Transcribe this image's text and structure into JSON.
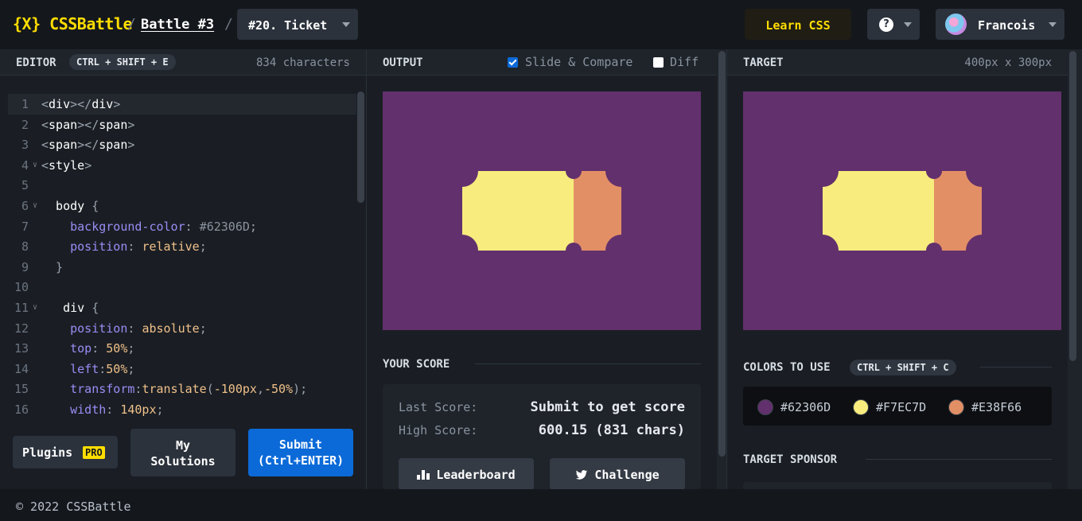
{
  "header": {
    "logo": "{X} CSSBattle",
    "separator": "/",
    "battle_label": "Battle #3",
    "target_label": "#20. Ticket",
    "learn_label": "Learn CSS",
    "help_label": "?",
    "user_name": "Francois"
  },
  "editor": {
    "title": "EDITOR",
    "shortcut": "CTRL + SHIFT + E",
    "char_count": "834 characters",
    "lines": [
      {
        "n": "1",
        "fold": false,
        "segs": [
          [
            "punc",
            "<"
          ],
          [
            "tag",
            "div"
          ],
          [
            "punc",
            "></"
          ],
          [
            "tag",
            "div"
          ],
          [
            "punc",
            ">"
          ]
        ]
      },
      {
        "n": "2",
        "fold": false,
        "segs": [
          [
            "punc",
            "<"
          ],
          [
            "tag",
            "span"
          ],
          [
            "punc",
            "></"
          ],
          [
            "tag",
            "span"
          ],
          [
            "punc",
            ">"
          ]
        ]
      },
      {
        "n": "3",
        "fold": false,
        "segs": [
          [
            "punc",
            "<"
          ],
          [
            "tag",
            "span"
          ],
          [
            "punc",
            "></"
          ],
          [
            "tag",
            "span"
          ],
          [
            "punc",
            ">"
          ]
        ]
      },
      {
        "n": "4",
        "fold": true,
        "segs": [
          [
            "punc",
            "<"
          ],
          [
            "tag",
            "style"
          ],
          [
            "punc",
            ">"
          ]
        ]
      },
      {
        "n": "5",
        "fold": false,
        "segs": []
      },
      {
        "n": "6",
        "fold": true,
        "segs": [
          [
            "tag",
            "  body "
          ],
          [
            "punc",
            "{"
          ]
        ]
      },
      {
        "n": "7",
        "fold": false,
        "segs": [
          [
            "prop",
            "    background-color"
          ],
          [
            "punc",
            ": "
          ],
          [
            "str",
            "#62306D"
          ],
          [
            "punc",
            ";"
          ]
        ]
      },
      {
        "n": "8",
        "fold": false,
        "segs": [
          [
            "prop",
            "    position"
          ],
          [
            "punc",
            ": "
          ],
          [
            "val",
            "relative"
          ],
          [
            "punc",
            ";"
          ]
        ]
      },
      {
        "n": "9",
        "fold": false,
        "segs": [
          [
            "punc",
            "  }"
          ]
        ]
      },
      {
        "n": "10",
        "fold": false,
        "segs": []
      },
      {
        "n": "11",
        "fold": true,
        "segs": [
          [
            "tag",
            "   div "
          ],
          [
            "punc",
            "{"
          ]
        ]
      },
      {
        "n": "12",
        "fold": false,
        "segs": [
          [
            "prop",
            "    position"
          ],
          [
            "punc",
            ": "
          ],
          [
            "val",
            "absolute"
          ],
          [
            "punc",
            ";"
          ]
        ]
      },
      {
        "n": "13",
        "fold": false,
        "segs": [
          [
            "prop",
            "    top"
          ],
          [
            "punc",
            ": "
          ],
          [
            "num",
            "50%"
          ],
          [
            "punc",
            ";"
          ]
        ]
      },
      {
        "n": "14",
        "fold": false,
        "segs": [
          [
            "prop",
            "    left"
          ],
          [
            "punc",
            ":"
          ],
          [
            "num",
            "50%"
          ],
          [
            "punc",
            ";"
          ]
        ]
      },
      {
        "n": "15",
        "fold": false,
        "segs": [
          [
            "prop",
            "    transform"
          ],
          [
            "punc",
            ":"
          ],
          [
            "val",
            "translate"
          ],
          [
            "punc",
            "("
          ],
          [
            "num",
            "-100px"
          ],
          [
            "punc",
            ","
          ],
          [
            "num",
            "-50%"
          ],
          [
            "punc",
            ");"
          ]
        ]
      },
      {
        "n": "16",
        "fold": false,
        "segs": [
          [
            "prop",
            "    width"
          ],
          [
            "punc",
            ": "
          ],
          [
            "num",
            "140px"
          ],
          [
            "punc",
            ";"
          ]
        ]
      }
    ],
    "plugins_label": "Plugins",
    "pro_badge": "PRO",
    "my_solutions_line1": "My",
    "my_solutions_line2": "Solutions",
    "submit_line1": "Submit",
    "submit_line2": "(Ctrl+ENTER)"
  },
  "output": {
    "title": "OUTPUT",
    "slide_compare_label": "Slide & Compare",
    "slide_compare_checked": true,
    "diff_label": "Diff",
    "diff_checked": false,
    "score_title": "YOUR SCORE",
    "last_score_label": "Last Score:",
    "last_score_value": "Submit to get score",
    "high_score_label": "High Score:",
    "high_score_value": "600.15 (831 chars)",
    "leaderboard_label": "Leaderboard",
    "challenge_label": "Challenge"
  },
  "target": {
    "title": "TARGET",
    "size": "400px x 300px",
    "colors_title": "COLORS TO USE",
    "colors_shortcut": "CTRL + SHIFT + C",
    "colors": [
      "#62306D",
      "#F7EC7D",
      "#E38F66"
    ],
    "sponsor_title": "TARGET SPONSOR"
  },
  "footer": {
    "copyright": "© 2022 CSSBattle"
  }
}
